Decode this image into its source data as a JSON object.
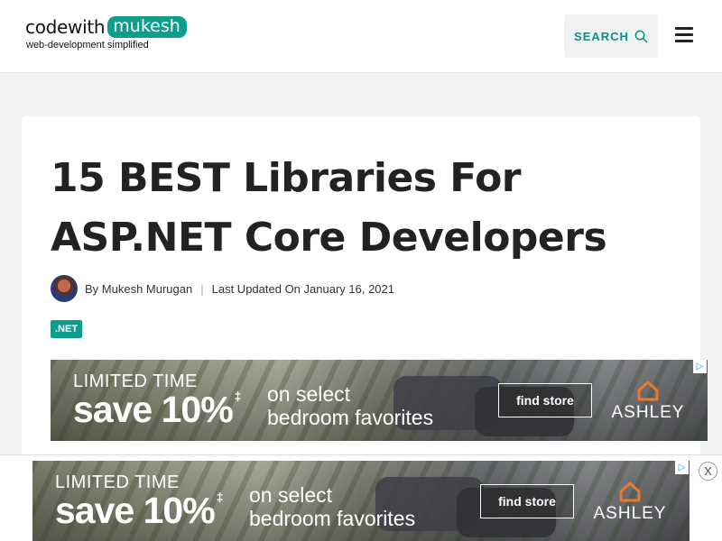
{
  "header": {
    "logo_part1": "codewith",
    "logo_part2": "mukesh",
    "tagline": "web-development simplified",
    "search_label": "SEARCH",
    "search_icon": "search-icon",
    "menu_icon": "hamburger-menu-icon"
  },
  "article": {
    "title": "15 BEST Libraries For ASP.NET Core Developers",
    "author": "By Mukesh Murugan",
    "separator": "|",
    "updated": "Last Updated On January 16, 2021",
    "category": ".NET"
  },
  "ad": {
    "limited": "LIMITED TIME",
    "save": "save 10%",
    "sup": "‡",
    "select_line1": "on select",
    "select_line2": "bedroom favorites",
    "button": "find store",
    "brand": "ASHLEY",
    "info": "▷"
  },
  "sticky_ad": {
    "close": "X"
  },
  "colors": {
    "accent": "#0e9e8c",
    "search_text": "#0e8f80"
  }
}
